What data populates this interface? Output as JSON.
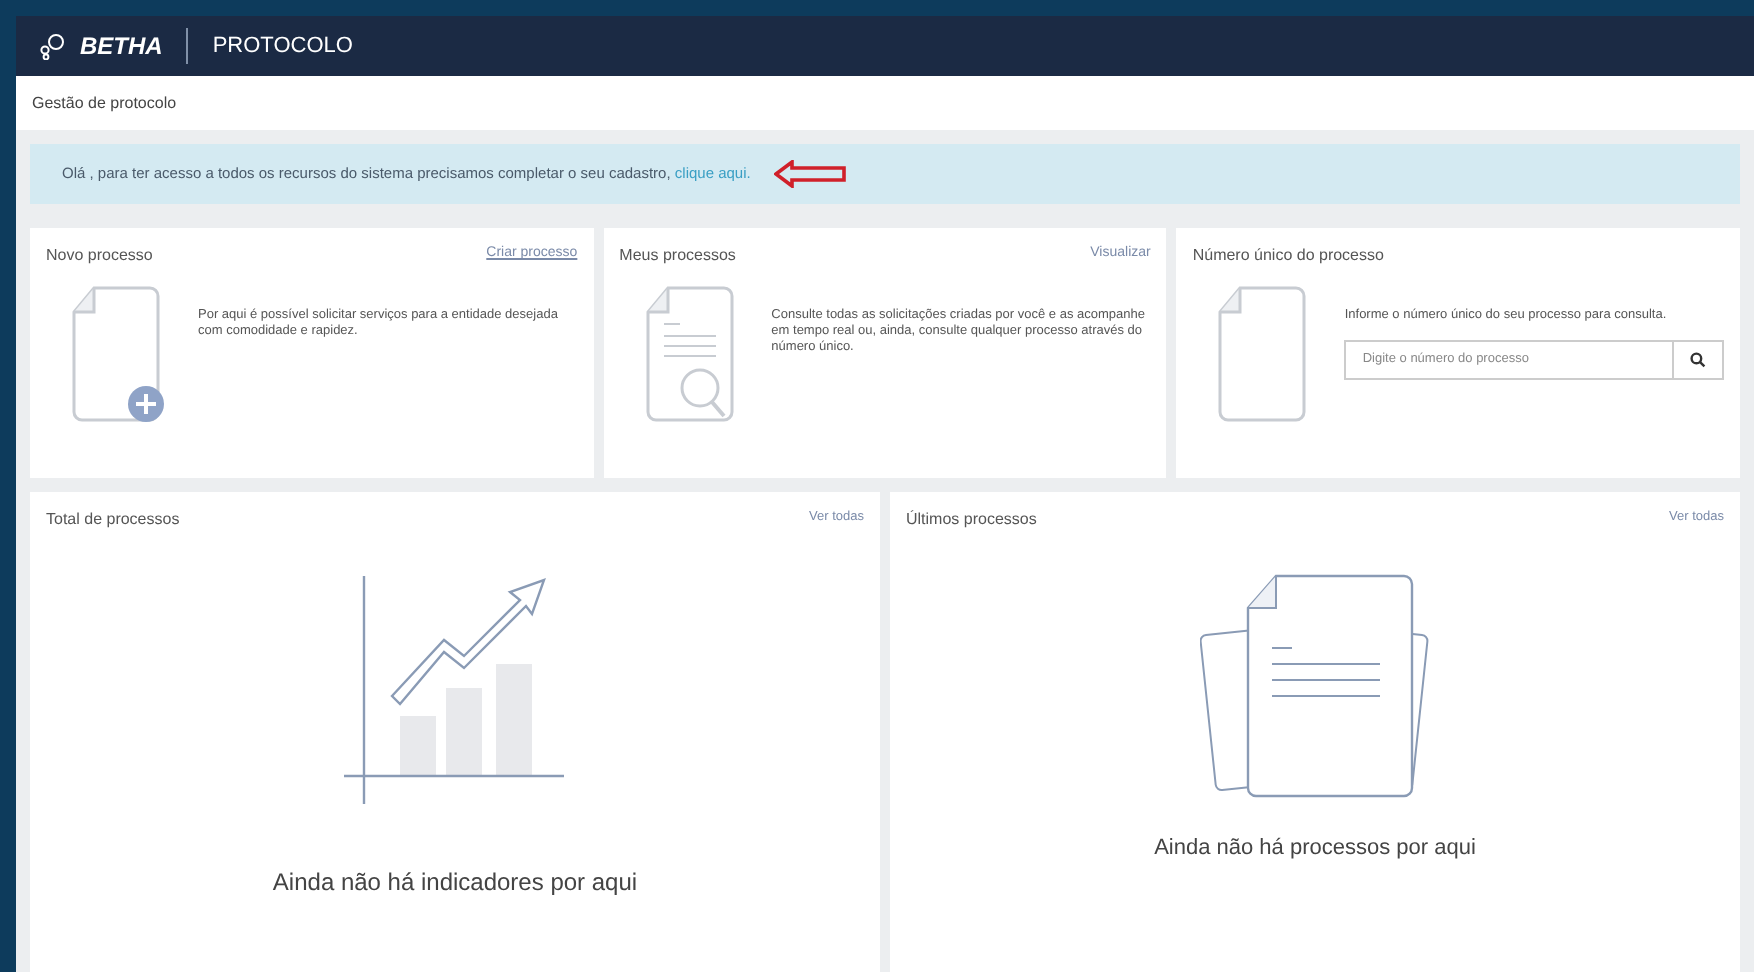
{
  "header": {
    "brand": "BETHA",
    "product": "PROTOCOLO"
  },
  "breadcrumb": "Gestão de protocolo",
  "alert": {
    "text": "Olá , para ter acesso a todos os recursos do sistema precisamos completar o seu cadastro,",
    "link": "clique aqui."
  },
  "cards": [
    {
      "kind": "new",
      "title": "Novo processo",
      "action": "Criar processo",
      "text": "Por aqui é possível solicitar serviços para a entidade desejada com comodidade e rapidez."
    },
    {
      "kind": "mine",
      "title": "Meus processos",
      "action": "Visualizar",
      "text": "Consulte todas as solicitações criadas por você e as acompanhe em tempo real ou, ainda, consulte qualquer processo através do número único."
    },
    {
      "kind": "search",
      "title": "Número único do processo",
      "text": "Informe o número único do seu processo para consulta.",
      "placeholder": "Digite o número do processo"
    }
  ],
  "panels": [
    {
      "kind": "chart",
      "title": "Total de processos",
      "action": "Ver todas",
      "empty": "Ainda não há indicadores por aqui"
    },
    {
      "kind": "docs",
      "title": "Últimos processos",
      "action": "Ver todas",
      "empty": "Ainda não há processos por aqui"
    }
  ]
}
